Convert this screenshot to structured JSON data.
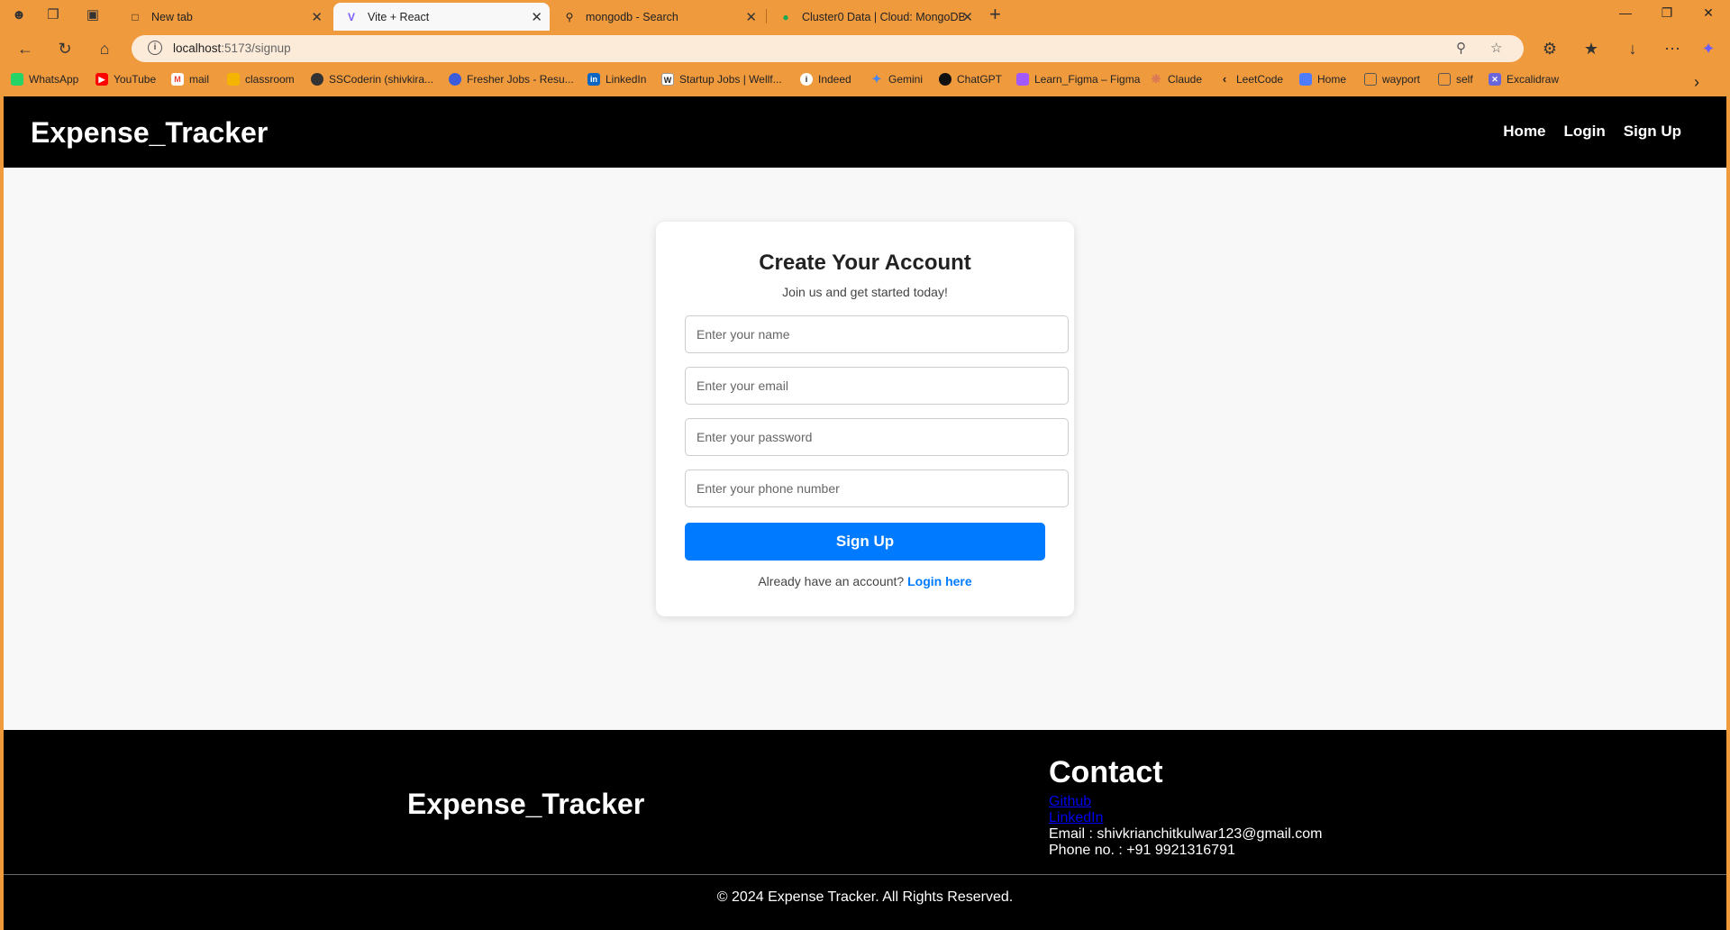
{
  "browser": {
    "tabs": [
      {
        "label": "New tab",
        "icon": "new-tab-page-icon"
      },
      {
        "label": "Vite + React",
        "icon": "vite-icon"
      },
      {
        "label": "mongodb - Search",
        "icon": "search-icon"
      },
      {
        "label": "Cluster0 Data | Cloud: MongoDB",
        "icon": "mongodb-icon"
      }
    ],
    "url_host": "localhost",
    "url_path": ":5173/signup",
    "bookmarks": [
      {
        "label": "WhatsApp",
        "color": "#25d366"
      },
      {
        "label": "YouTube",
        "color": "#ff0000"
      },
      {
        "label": "mail",
        "color": "#ea4335"
      },
      {
        "label": "classroom",
        "color": "#f4b400"
      },
      {
        "label": "SSCoderin (shivkira...",
        "color": "#333333"
      },
      {
        "label": "Fresher Jobs - Resu...",
        "color": "#3b5bdb"
      },
      {
        "label": "LinkedIn",
        "color": "#0a66c2"
      },
      {
        "label": "Startup Jobs | Wellf...",
        "color": "#ffffff"
      },
      {
        "label": "Indeed",
        "color": "#ffffff"
      },
      {
        "label": "Gemini",
        "color": "#4285f4"
      },
      {
        "label": "ChatGPT",
        "color": "#111111"
      },
      {
        "label": "Learn_Figma – Figma",
        "color": "#a259ff"
      },
      {
        "label": "Claude",
        "color": "#d97757"
      },
      {
        "label": "LeetCode",
        "color": "#ffa116"
      },
      {
        "label": "Home",
        "color": "#4f7cff"
      },
      {
        "label": "wayport",
        "color": "#555555"
      },
      {
        "label": "self",
        "color": "#555555"
      },
      {
        "label": "Excalidraw",
        "color": "#6965db"
      }
    ]
  },
  "header": {
    "brand": "Expense_Tracker",
    "nav": [
      "Home",
      "Login",
      "Sign Up"
    ]
  },
  "signup": {
    "title": "Create Your Account",
    "subtitle": "Join us and get started today!",
    "name_placeholder": "Enter your name",
    "email_placeholder": "Enter your email",
    "password_placeholder": "Enter your password",
    "phone_placeholder": "Enter your phone number",
    "button": "Sign Up",
    "already_text": "Already have an account?",
    "login_link": "Login here"
  },
  "footer": {
    "brand": "Expense_Tracker",
    "contact_title": "Contact",
    "github": "Github",
    "linkedin": "LinkedIn",
    "email": "Email : shivkrianchitkulwar123@gmail.com",
    "phone": "Phone no. : +91 9921316791",
    "copyright": "© 2024 Expense Tracker. All Rights Reserved."
  },
  "colors": {
    "chrome": "#f09a3e",
    "primary": "#007bff",
    "header_bg": "#000000",
    "page_bg": "#f8f8f8"
  }
}
